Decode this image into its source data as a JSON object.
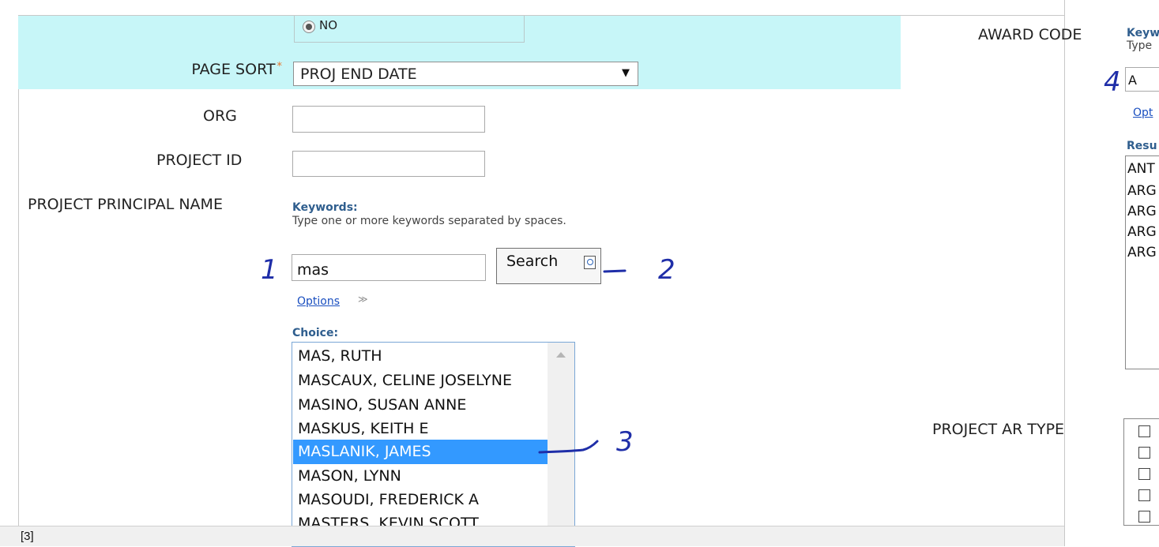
{
  "search_criteria": {
    "radio_option": {
      "label": "NO",
      "selected": true
    },
    "page_sort": {
      "label": "PAGE SORT",
      "required_mark": "*",
      "value": "PROJ END DATE"
    },
    "org": {
      "label": "ORG",
      "value": ""
    },
    "project_id": {
      "label": "PROJECT ID",
      "value": ""
    },
    "principal_name": {
      "label": "PROJECT PRINCIPAL NAME",
      "keywords_heading": "Keywords:",
      "keywords_help": "Type one or more keywords separated by spaces.",
      "search_value": "mas",
      "search_button": "Search",
      "options_link": "Options",
      "choice_heading": "Choice:",
      "choices": [
        "MAS, RUTH",
        "MASCAUX, CELINE JOSELYNE",
        "MASINO, SUSAN ANNE",
        "MASKUS, KEITH E",
        "MASLANIK, JAMES",
        "MASON, LYNN",
        "MASOUDI, FREDERICK A",
        "MASTERS, KEVIN SCOTT"
      ],
      "selected_choice": "MASLANIK, JAMES"
    },
    "award_code": {
      "label": "AWARD CODE",
      "keywords_heading": "Keyw",
      "keywords_help": "Type",
      "search_value": "A",
      "options_link": "Opt",
      "results_heading": "Resu",
      "results": [
        "ANT",
        "ARG",
        "ARG",
        "ARG",
        "ARG"
      ]
    },
    "project_ar_type": {
      "label": "PROJECT AR TYPE",
      "checkbox_count": 6
    }
  },
  "annotations": [
    "1",
    "2",
    "3",
    "4"
  ],
  "caption": "[3]",
  "colors": {
    "form_highlight": "#c7f6f8",
    "selection": "#3399ff",
    "annotation_ink": "#1f2ea8",
    "link": "#1a4fc0",
    "heading": "#2f5e8e"
  }
}
